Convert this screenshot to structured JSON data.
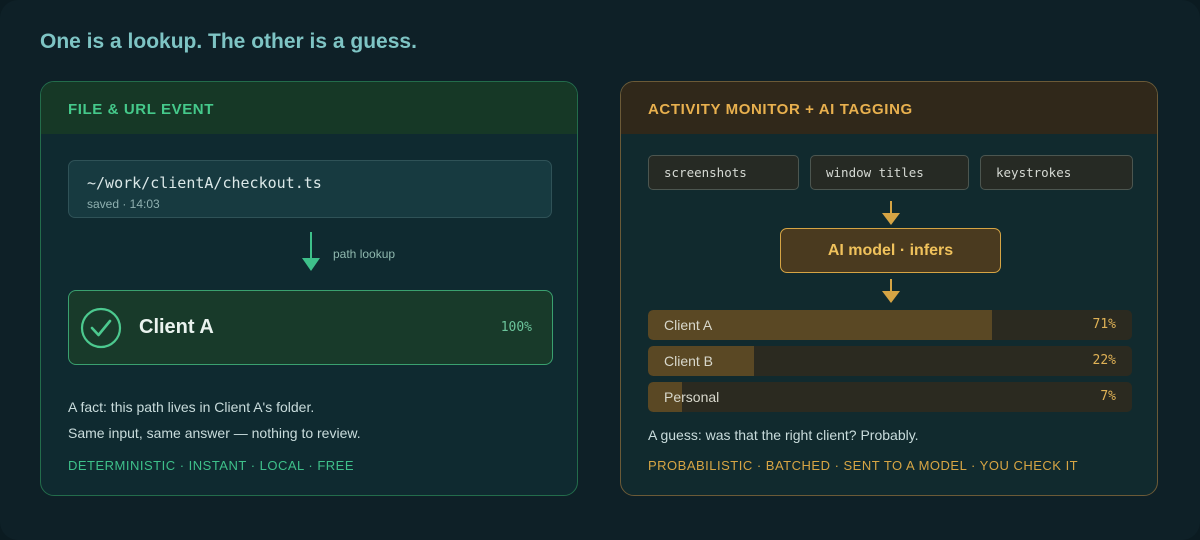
{
  "headline": "One is a lookup. The other is a guess.",
  "left": {
    "title": "FILE & URL EVENT",
    "path": "~/work/clientA/checkout.ts",
    "path_meta": "saved · 14:03",
    "arrow_label": "path lookup",
    "result": {
      "name": "Client A",
      "confidence": "100%"
    },
    "fact_line1": "A fact: this path lives in Client A's folder.",
    "fact_line2": "Same input, same answer — nothing to review.",
    "tags": "DETERMINISTIC · INSTANT · LOCAL · FREE",
    "accent": "#45c98b"
  },
  "right": {
    "title": "ACTIVITY MONITOR + AI TAGGING",
    "inputs": [
      "screenshots",
      "window titles",
      "keystrokes"
    ],
    "model_label": "AI model · infers",
    "guesses": [
      {
        "label": "Client A",
        "pct_text": "71%",
        "fraction": 0.71
      },
      {
        "label": "Client B",
        "pct_text": "22%",
        "fraction": 0.22
      },
      {
        "label": "Personal",
        "pct_text": "7%",
        "fraction": 0.07
      }
    ],
    "guess_note": "A guess: was that the right client? Probably.",
    "tags": "PROBABILISTIC · BATCHED · SENT TO A MODEL · YOU CHECK IT",
    "accent": "#e8b04e"
  }
}
